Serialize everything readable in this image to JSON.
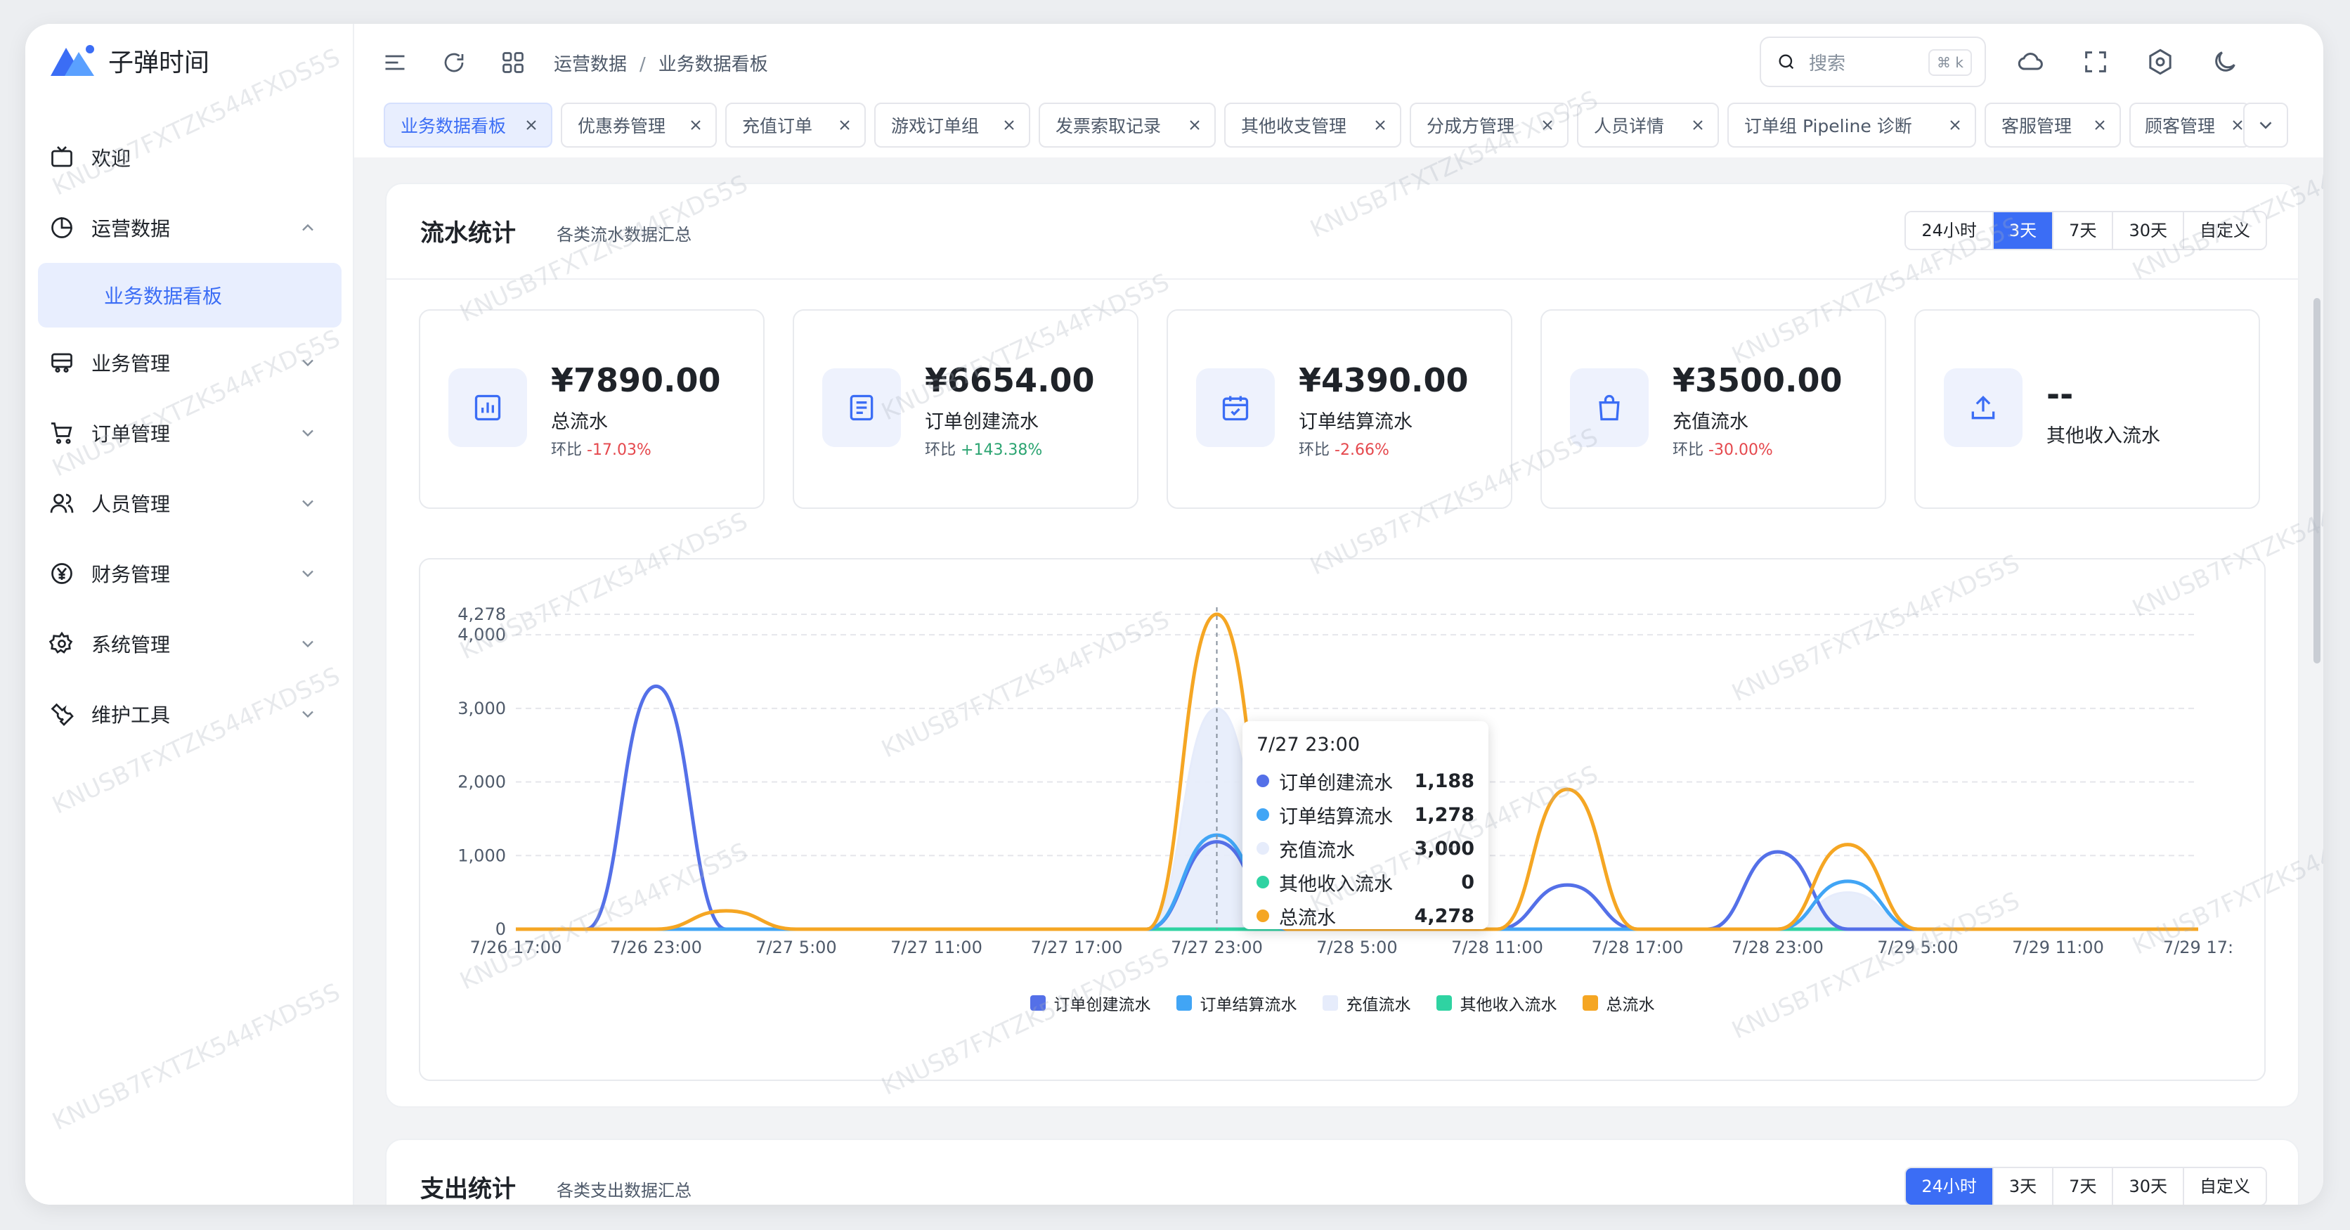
{
  "app": {
    "name": "子弹时间"
  },
  "sidebar": {
    "items": [
      {
        "label": "欢迎",
        "icon": "tv-icon"
      },
      {
        "label": "运营数据",
        "icon": "pie-chart-icon",
        "expanded": true
      },
      {
        "label": "业务管理",
        "icon": "business-icon"
      },
      {
        "label": "订单管理",
        "icon": "cart-icon"
      },
      {
        "label": "人员管理",
        "icon": "users-icon"
      },
      {
        "label": "财务管理",
        "icon": "yen-icon"
      },
      {
        "label": "系统管理",
        "icon": "gear-icon"
      },
      {
        "label": "维护工具",
        "icon": "wrench-icon"
      }
    ],
    "active_sub": "业务数据看板"
  },
  "header": {
    "breadcrumb": [
      "运营数据",
      "业务数据看板"
    ],
    "search_placeholder": "搜索",
    "search_shortcut": "⌘ k"
  },
  "tabs": [
    {
      "label": "业务数据看板",
      "active": true
    },
    {
      "label": "优惠券管理"
    },
    {
      "label": "充值订单"
    },
    {
      "label": "游戏订单组"
    },
    {
      "label": "发票索取记录"
    },
    {
      "label": "其他收支管理"
    },
    {
      "label": "分成方管理"
    },
    {
      "label": "人员详情"
    },
    {
      "label": "订单组 Pipeline 诊断"
    },
    {
      "label": "客服管理"
    },
    {
      "label": "顾客管理"
    }
  ],
  "revenue": {
    "title": "流水统计",
    "subtitle": "各类流水数据汇总",
    "ranges": [
      "24小时",
      "3天",
      "7天",
      "30天",
      "自定义"
    ],
    "active_range": "3天",
    "stats": [
      {
        "amount": "¥7890.00",
        "label": "总流水",
        "compare_label": "环比",
        "compare": "-17.03%",
        "trend": "down",
        "icon": "bar-chart-icon"
      },
      {
        "amount": "¥6654.00",
        "label": "订单创建流水",
        "compare_label": "环比",
        "compare": "+143.38%",
        "trend": "up",
        "icon": "document-icon"
      },
      {
        "amount": "¥4390.00",
        "label": "订单结算流水",
        "compare_label": "环比",
        "compare": "-2.66%",
        "trend": "down",
        "icon": "calendar-check-icon"
      },
      {
        "amount": "¥3500.00",
        "label": "充值流水",
        "compare_label": "环比",
        "compare": "-30.00%",
        "trend": "down",
        "icon": "bag-icon"
      },
      {
        "amount": "--",
        "label": "其他收入流水",
        "icon": "upload-icon"
      }
    ],
    "tooltip": {
      "title": "7/27 23:00",
      "rows": [
        {
          "name": "订单创建流水",
          "value": "1,188"
        },
        {
          "name": "订单结算流水",
          "value": "1,278"
        },
        {
          "name": "充值流水",
          "value": "3,000"
        },
        {
          "name": "其他收入流水",
          "value": "0"
        },
        {
          "name": "总流水",
          "value": "4,278"
        }
      ]
    }
  },
  "expense": {
    "title": "支出统计",
    "subtitle": "各类支出数据汇总",
    "ranges": [
      "24小时",
      "3天",
      "7天",
      "30天",
      "自定义"
    ],
    "active_range": "24小时"
  },
  "watermark": "KNUSB7FXTZK544FXDS5S",
  "colors": {
    "accent": "#3b6df5",
    "order_create": "#5470e8",
    "order_settle": "#41a5f5",
    "recharge": "#e6ecfb",
    "other_income": "#2fd3a2",
    "total": "#f5a623"
  },
  "chart_data": {
    "type": "area",
    "x": [
      "7/26 17:00",
      "7/26 20:00",
      "7/26 23:00",
      "7/27 2:00",
      "7/27 5:00",
      "7/27 8:00",
      "7/27 11:00",
      "7/27 14:00",
      "7/27 17:00",
      "7/27 20:00",
      "7/27 23:00",
      "7/28 2:00",
      "7/28 5:00",
      "7/28 8:00",
      "7/28 11:00",
      "7/28 14:00",
      "7/28 17:00",
      "7/28 20:00",
      "7/28 23:00",
      "7/29 2:00",
      "7/29 5:00",
      "7/29 8:00",
      "7/29 11:00",
      "7/29 14:00",
      "7/29 17:00"
    ],
    "xticks": [
      "7/26 17:00",
      "7/26 23:00",
      "7/27 5:00",
      "7/27 11:00",
      "7/27 17:00",
      "7/27 23:00",
      "7/28 5:00",
      "7/28 11:00",
      "7/28 17:00",
      "7/28 23:00",
      "7/29 5:00",
      "7/29 11:00",
      "7/29 17:"
    ],
    "yticks": [
      "0",
      "1,000",
      "2,000",
      "3,000",
      "4,000",
      "4,278"
    ],
    "ylim": [
      0,
      4278
    ],
    "series": [
      {
        "name": "订单创建流水",
        "color": "#5470e8",
        "values": [
          0,
          0,
          3300,
          0,
          0,
          0,
          0,
          0,
          0,
          0,
          1188,
          0,
          0,
          0,
          0,
          600,
          0,
          0,
          1050,
          0,
          0,
          0,
          0,
          0,
          0
        ]
      },
      {
        "name": "订单结算流水",
        "color": "#41a5f5",
        "values": [
          0,
          0,
          0,
          0,
          0,
          0,
          0,
          0,
          0,
          0,
          1278,
          0,
          0,
          0,
          0,
          0,
          0,
          0,
          0,
          650,
          0,
          0,
          0,
          0,
          0
        ]
      },
      {
        "name": "充值流水",
        "color": "#e6ecfb",
        "values": [
          0,
          0,
          0,
          0,
          0,
          0,
          0,
          0,
          0,
          0,
          3000,
          0,
          0,
          0,
          0,
          0,
          0,
          0,
          0,
          500,
          0,
          0,
          0,
          0,
          0
        ]
      },
      {
        "name": "其他收入流水",
        "color": "#2fd3a2",
        "values": [
          0,
          0,
          0,
          0,
          0,
          0,
          0,
          0,
          0,
          0,
          0,
          0,
          0,
          0,
          0,
          0,
          0,
          0,
          0,
          0,
          0,
          0,
          0,
          0,
          0
        ]
      },
      {
        "name": "总流水",
        "color": "#f5a623",
        "values": [
          0,
          0,
          0,
          250,
          0,
          0,
          0,
          0,
          0,
          0,
          4278,
          0,
          0,
          0,
          0,
          1900,
          0,
          0,
          0,
          1150,
          0,
          0,
          0,
          0,
          0
        ]
      }
    ],
    "legend_position": "bottom",
    "grid": true
  }
}
